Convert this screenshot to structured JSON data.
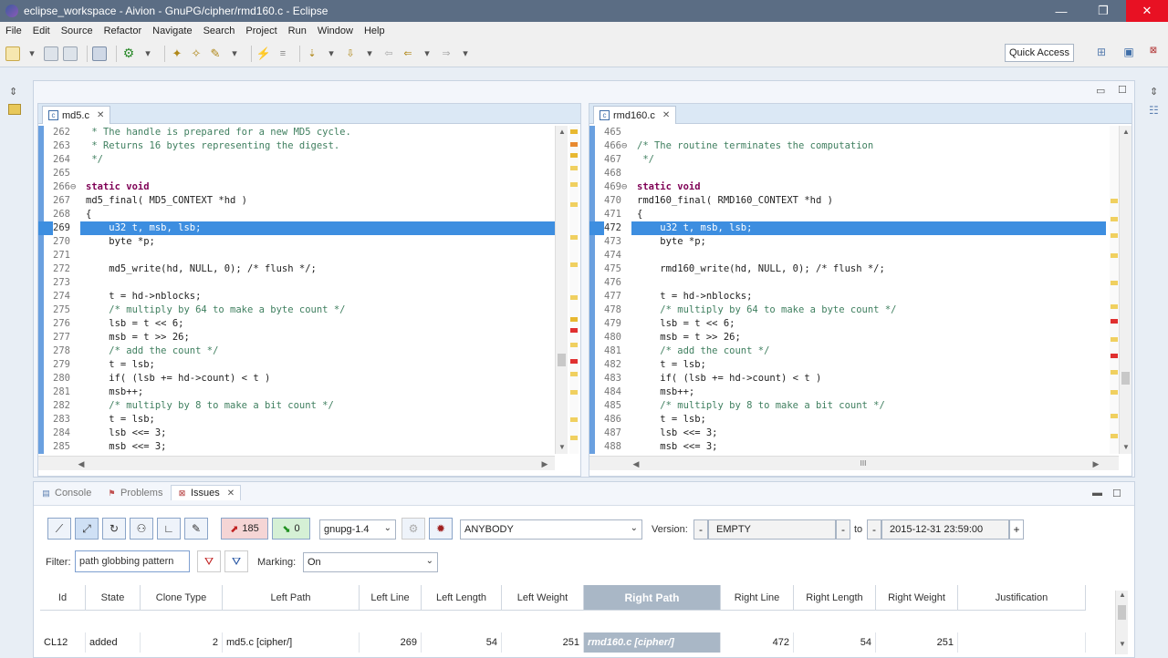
{
  "window": {
    "title": "eclipse_workspace - Aivion - GnuPG/cipher/rmd160.c - Eclipse",
    "min_glyph": "—",
    "max_glyph": "❐",
    "close_glyph": "✕"
  },
  "menu": [
    "File",
    "Edit",
    "Source",
    "Refactor",
    "Navigate",
    "Search",
    "Project",
    "Run",
    "Window",
    "Help"
  ],
  "toolbar": {
    "quick_access": "Quick Access"
  },
  "editors": {
    "left": {
      "tab": "md5.c",
      "lines": [
        {
          "n": "262",
          "t": " * The handle is prepared for a new MD5 cycle.",
          "c": "cmt"
        },
        {
          "n": "263",
          "t": " * Returns 16 bytes representing the digest.",
          "c": "cmt"
        },
        {
          "n": "264",
          "t": " */",
          "c": "cmt"
        },
        {
          "n": "265",
          "t": "",
          "c": ""
        },
        {
          "n": "266⊖",
          "t": "static void",
          "c": "kw"
        },
        {
          "n": "267",
          "t": "md5_final( MD5_CONTEXT *hd )",
          "c": ""
        },
        {
          "n": "268",
          "t": "{",
          "c": ""
        },
        {
          "n": "269",
          "t": "    u32 t, msb, lsb;",
          "c": "hl"
        },
        {
          "n": "270",
          "t": "    byte *p;",
          "c": ""
        },
        {
          "n": "271",
          "t": "",
          "c": ""
        },
        {
          "n": "272",
          "t": "    md5_write(hd, NULL, 0); /* flush */;",
          "c": ""
        },
        {
          "n": "273",
          "t": "",
          "c": ""
        },
        {
          "n": "274",
          "t": "    t = hd->nblocks;",
          "c": ""
        },
        {
          "n": "275",
          "t": "    /* multiply by 64 to make a byte count */",
          "c": "cmt"
        },
        {
          "n": "276",
          "t": "    lsb = t << 6;",
          "c": ""
        },
        {
          "n": "277",
          "t": "    msb = t >> 26;",
          "c": ""
        },
        {
          "n": "278",
          "t": "    /* add the count */",
          "c": "cmt"
        },
        {
          "n": "279",
          "t": "    t = lsb;",
          "c": ""
        },
        {
          "n": "280",
          "t": "    if( (lsb += hd->count) < t )",
          "c": ""
        },
        {
          "n": "281",
          "t": "    msb++;",
          "c": ""
        },
        {
          "n": "282",
          "t": "    /* multiply by 8 to make a bit count */",
          "c": "cmt"
        },
        {
          "n": "283",
          "t": "    t = lsb;",
          "c": ""
        },
        {
          "n": "284",
          "t": "    lsb <<= 3;",
          "c": ""
        },
        {
          "n": "285",
          "t": "    msb <<= 3;",
          "c": ""
        }
      ]
    },
    "right": {
      "tab": "rmd160.c",
      "lines": [
        {
          "n": "465",
          "t": "",
          "c": ""
        },
        {
          "n": "466⊖",
          "t": "/* The routine terminates the computation",
          "c": "cmt"
        },
        {
          "n": "467",
          "t": " */",
          "c": "cmt"
        },
        {
          "n": "468",
          "t": "",
          "c": ""
        },
        {
          "n": "469⊖",
          "t": "static void",
          "c": "kw"
        },
        {
          "n": "470",
          "t": "rmd160_final( RMD160_CONTEXT *hd )",
          "c": ""
        },
        {
          "n": "471",
          "t": "{",
          "c": ""
        },
        {
          "n": "472",
          "t": "    u32 t, msb, lsb;",
          "c": "hl"
        },
        {
          "n": "473",
          "t": "    byte *p;",
          "c": ""
        },
        {
          "n": "474",
          "t": "",
          "c": ""
        },
        {
          "n": "475",
          "t": "    rmd160_write(hd, NULL, 0); /* flush */;",
          "c": ""
        },
        {
          "n": "476",
          "t": "",
          "c": ""
        },
        {
          "n": "477",
          "t": "    t = hd->nblocks;",
          "c": ""
        },
        {
          "n": "478",
          "t": "    /* multiply by 64 to make a byte count */",
          "c": "cmt"
        },
        {
          "n": "479",
          "t": "    lsb = t << 6;",
          "c": ""
        },
        {
          "n": "480",
          "t": "    msb = t >> 26;",
          "c": ""
        },
        {
          "n": "481",
          "t": "    /* add the count */",
          "c": "cmt"
        },
        {
          "n": "482",
          "t": "    t = lsb;",
          "c": ""
        },
        {
          "n": "483",
          "t": "    if( (lsb += hd->count) < t )",
          "c": ""
        },
        {
          "n": "484",
          "t": "    msb++;",
          "c": ""
        },
        {
          "n": "485",
          "t": "    /* multiply by 8 to make a bit count */",
          "c": "cmt"
        },
        {
          "n": "486",
          "t": "    t = lsb;",
          "c": ""
        },
        {
          "n": "487",
          "t": "    lsb <<= 3;",
          "c": ""
        },
        {
          "n": "488",
          "t": "    msb <<= 3;",
          "c": ""
        }
      ]
    }
  },
  "bottom": {
    "tabs": {
      "console": "Console",
      "problems": "Problems",
      "issues": "Issues"
    },
    "up_count": "185",
    "down_count": "0",
    "project": "gnupg-1.4",
    "category": "ANYBODY",
    "version_label": "Version:",
    "version_value": "EMPTY",
    "to_label": "to",
    "date_value": "2015-12-31 23:59:00",
    "filter_label": "Filter:",
    "filter_placeholder": "path globbing pattern",
    "marking_label": "Marking:",
    "marking_value": "On",
    "columns": [
      "Id",
      "State",
      "Clone Type",
      "Left Path",
      "Left Line",
      "Left Length",
      "Left Weight",
      "Right Path",
      "Right Line",
      "Right Length",
      "Right Weight",
      "Justification"
    ],
    "row": {
      "id": "CL12",
      "state": "added",
      "clone_type": "2",
      "left_path": "md5.c [cipher/]",
      "left_line": "269",
      "left_length": "54",
      "left_weight": "251",
      "right_path": "rmd160.c [cipher/]",
      "right_line": "472",
      "right_length": "54",
      "right_weight": "251",
      "justification": ""
    }
  },
  "colors": {
    "title_bar": "#5b6d84",
    "selection": "#3d8ee0",
    "sorted_column": "#a9b7c6"
  }
}
